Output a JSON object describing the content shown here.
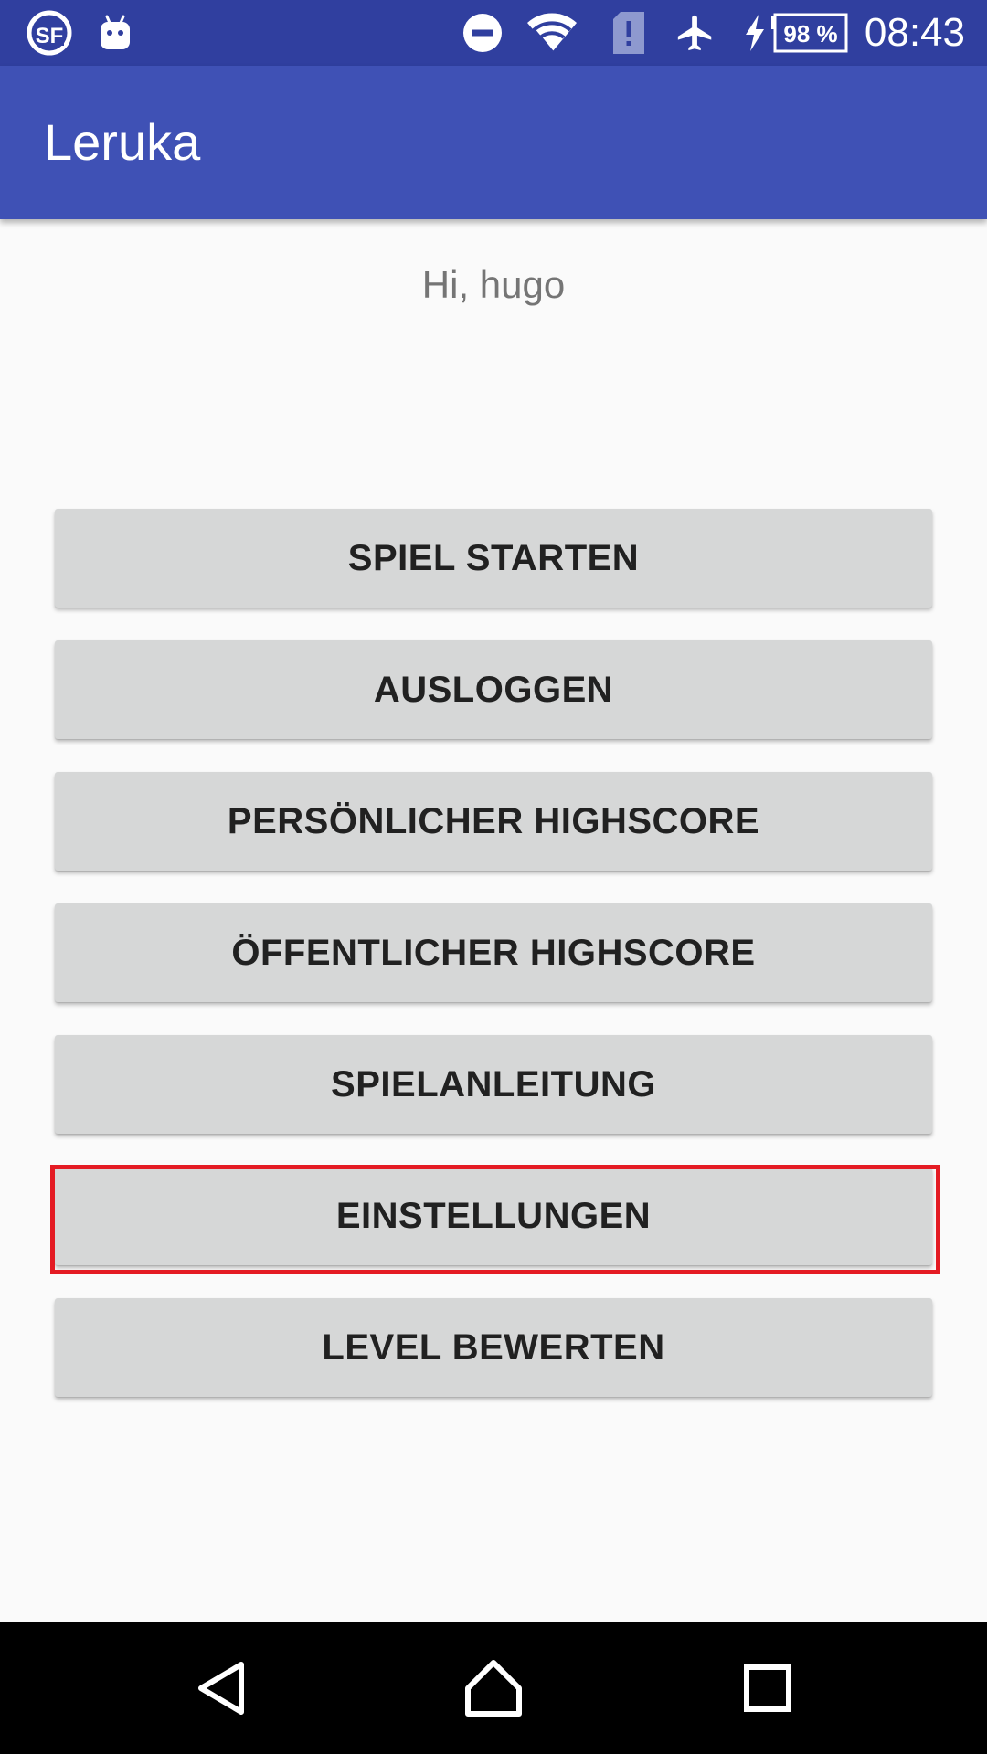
{
  "status_bar": {
    "time": "08:43",
    "battery_percent": "98 %",
    "icons": [
      "sf-app-icon",
      "android-debug-icon",
      "do-not-disturb-icon",
      "wifi-icon",
      "sim-alert-icon",
      "airplane-mode-icon",
      "charging-bolt-icon",
      "battery-icon"
    ],
    "background_color": "#303f9f"
  },
  "app_bar": {
    "title": "Leruka",
    "background_color": "#3f51b5"
  },
  "greeting": "Hi, hugo",
  "menu": {
    "buttons": [
      {
        "label": "SPIEL STARTEN"
      },
      {
        "label": "AUSLOGGEN"
      },
      {
        "label": "PERSÖNLICHER HIGHSCORE"
      },
      {
        "label": "ÖFFENTLICHER HIGHSCORE"
      },
      {
        "label": "SPIELANLEITUNG"
      },
      {
        "label": "EINSTELLUNGEN",
        "highlighted": true
      },
      {
        "label": "LEVEL BEWERTEN"
      }
    ],
    "button_color": "#d6d7d7",
    "highlight_color": "#e41b23"
  },
  "nav_bar": {
    "icons": [
      "back-icon",
      "home-icon",
      "recents-icon"
    ]
  }
}
